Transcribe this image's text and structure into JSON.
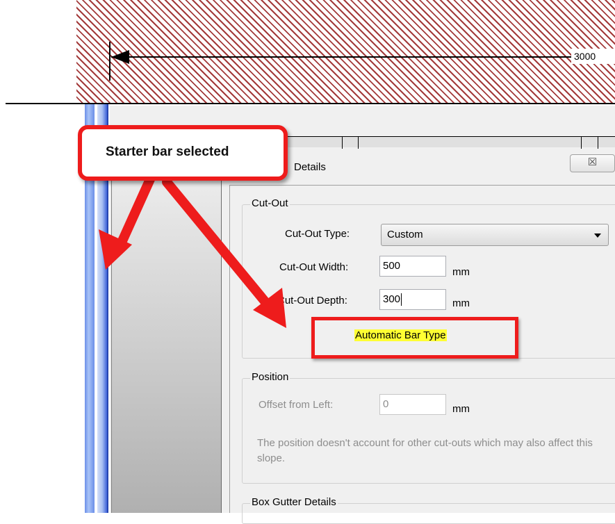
{
  "drawing": {
    "dimension_label": "3000"
  },
  "dialog": {
    "title": "Details",
    "close_glyph": "☒",
    "cutout_group": {
      "title": "Cut-Out",
      "type_label": "Cut-Out Type:",
      "type_value": "Custom",
      "width_label": "Cut-Out Width:",
      "width_value": "500",
      "width_unit": "mm",
      "depth_label": "Cut-Out Depth:",
      "depth_value": "300",
      "depth_unit": "mm",
      "bar_type": "Automatic Bar Type"
    },
    "position_group": {
      "title": "Position",
      "offset_label": "Offset from Left:",
      "offset_value": "0",
      "offset_unit": "mm",
      "hint": "The position doesn't account for other cut-outs which may also affect this slope."
    },
    "gutter_group": {
      "title": "Box Gutter Details"
    }
  },
  "callout": {
    "text": "Starter bar selected",
    "color": "#ee1c1c"
  },
  "colors": {
    "hatch": "#a33a3a",
    "highlight": "#ffff33",
    "blue_bar": "#6b8fe8"
  }
}
